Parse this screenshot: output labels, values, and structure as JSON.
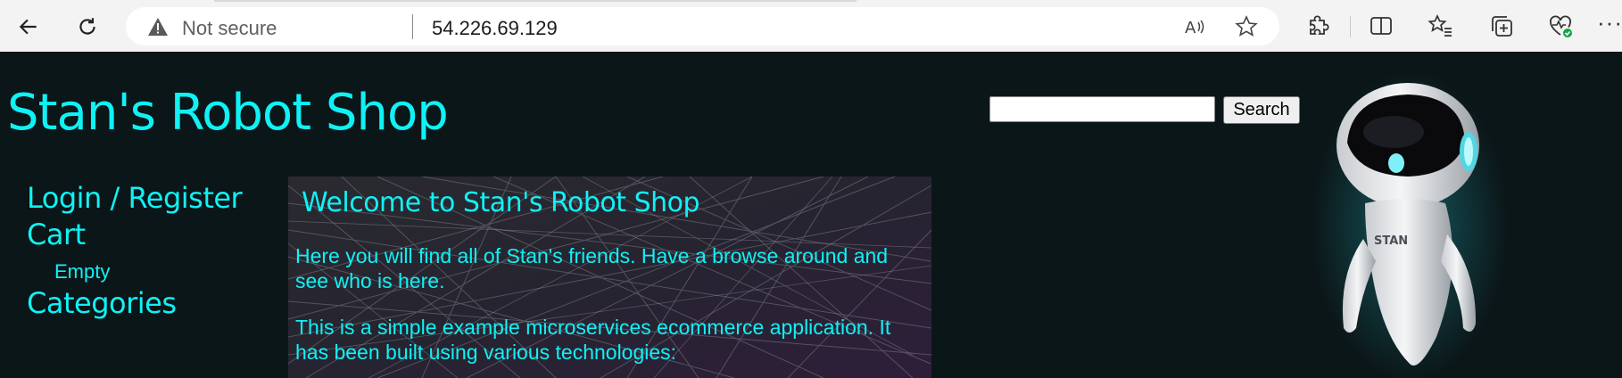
{
  "browser": {
    "security_label": "Not secure",
    "url": "54.226.69.129",
    "icons": [
      "back-icon",
      "refresh-icon",
      "warning-icon",
      "read-aloud-icon",
      "favorite-star-icon",
      "extensions-icon",
      "split-screen-icon",
      "favorites-icon",
      "collections-icon",
      "performance-icon",
      "more-icon"
    ],
    "more_label": "···"
  },
  "shop": {
    "title": "Stan's Robot Shop",
    "search_button": "Search",
    "search_value": ""
  },
  "nav": {
    "login": "Login / Register",
    "cart": "Cart",
    "cart_status": "Empty",
    "categories": "Categories"
  },
  "welcome": {
    "heading": "Welcome to Stan's Robot Shop",
    "para1": "Here you will find all of Stan's friends. Have a browse around and see who is here.",
    "para2": "This is a simple example microservices ecommerce application. It has been built using various technologies:"
  },
  "robot": {
    "badge": "STAN"
  },
  "colors": {
    "accent": "#0ff2f5",
    "page_bg": "#0b1618",
    "chrome_bg": "#f3f3f3"
  }
}
